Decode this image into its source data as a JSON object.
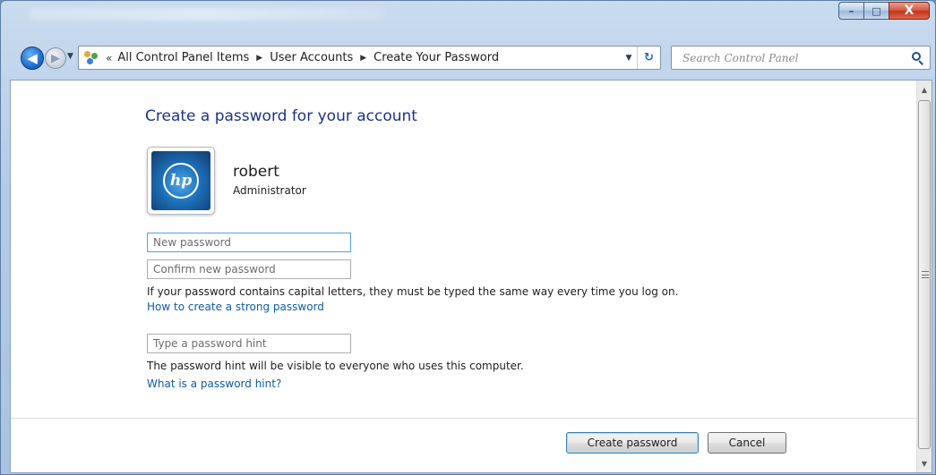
{
  "window": {
    "controls": {
      "minimize": "–",
      "maximize": "□",
      "close": "X"
    }
  },
  "nav": {
    "back_glyph": "◀",
    "forward_glyph": "▶",
    "dropdown_glyph": "▼",
    "crumb_overflow": "«",
    "crumb_separator": "▶",
    "breadcrumbs": [
      "All Control Panel Items",
      "User Accounts",
      "Create Your Password"
    ],
    "address_dropdown": "▼",
    "refresh_glyph": "↻",
    "search_placeholder": "Search Control Panel"
  },
  "main": {
    "title": "Create a password for your account",
    "user": {
      "name": "robert",
      "role": "Administrator",
      "avatar_logo": "hp"
    },
    "fields": {
      "new_password_placeholder": "New password",
      "confirm_password_placeholder": "Confirm new password",
      "hint_placeholder": "Type a password hint"
    },
    "notes": {
      "capitals": "If your password contains capital letters, they must be typed the same way every time you log on.",
      "hint_visibility": "The password hint will be visible to everyone who uses this computer."
    },
    "links": {
      "strong_password": "How to create a strong password",
      "what_is_hint": "What is a password hint?"
    },
    "buttons": {
      "create": "Create password",
      "cancel": "Cancel"
    }
  },
  "scrollbar": {
    "up": "▲",
    "down": "▼"
  },
  "colors": {
    "title_blue": "#1e3287",
    "link_blue": "#0f5aa6",
    "frame_blue": "#b4cbe6",
    "close_red": "#c2341c"
  }
}
